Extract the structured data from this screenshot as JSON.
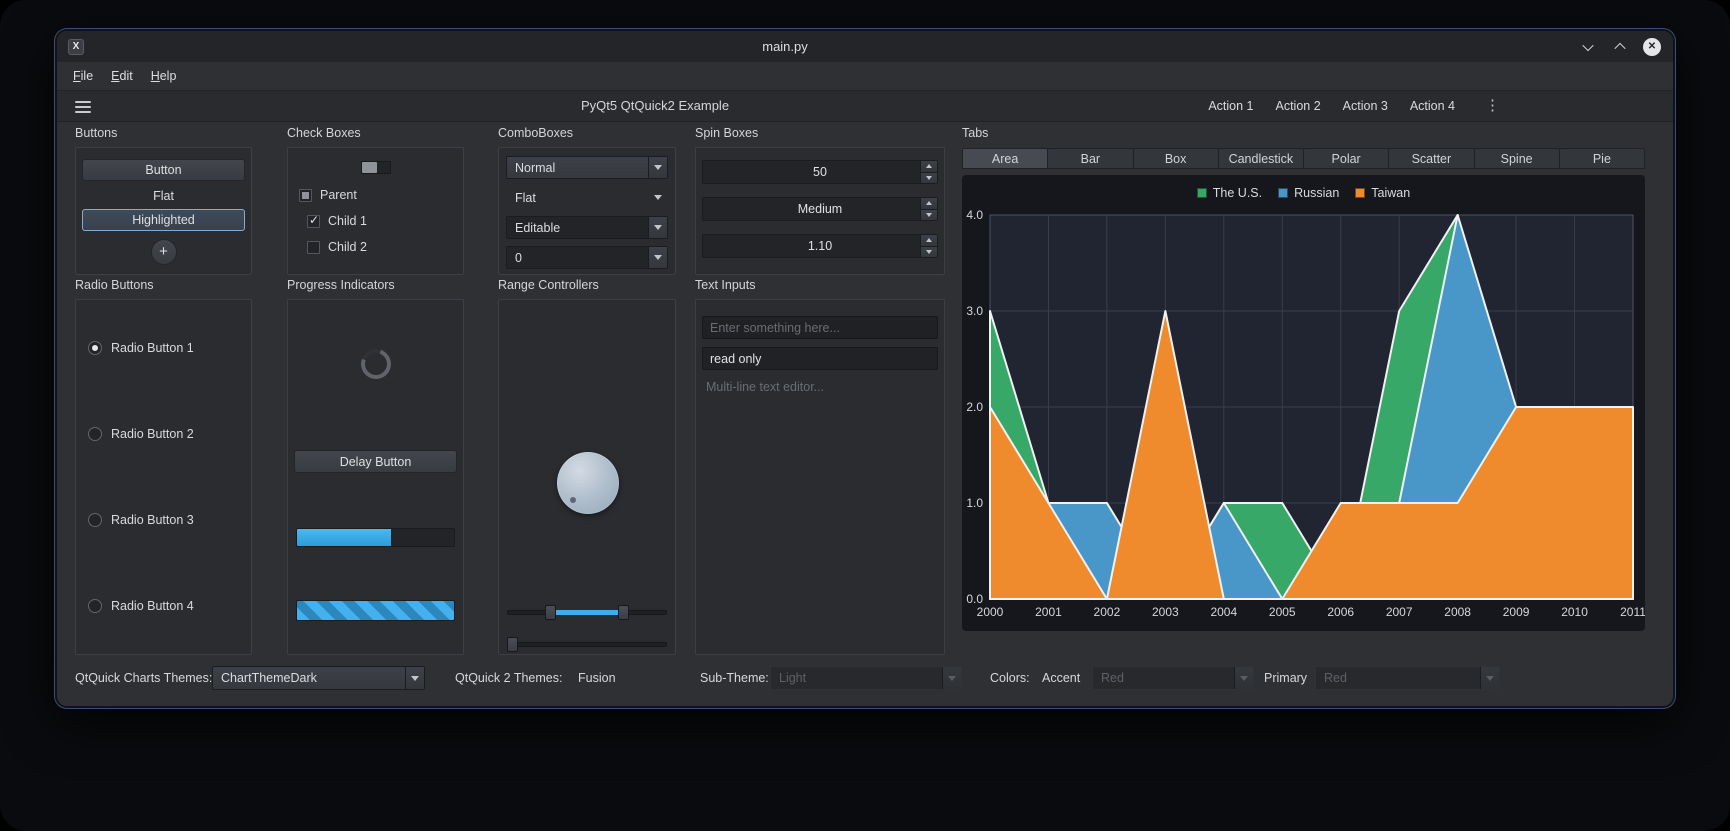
{
  "window": {
    "title": "main.py"
  },
  "icons": {
    "app": "X",
    "close": "✕",
    "round_plus": "+"
  },
  "menubar": {
    "items": [
      "File",
      "Edit",
      "Help"
    ]
  },
  "toolbar": {
    "title": "PyQt5 QtQuick2 Example",
    "actions": [
      "Action 1",
      "Action 2",
      "Action 3",
      "Action 4"
    ]
  },
  "groups": {
    "buttons": {
      "title": "Buttons",
      "normal": "Button",
      "flat": "Flat",
      "highlighted": "Highlighted",
      "round": "+"
    },
    "checkboxes": {
      "title": "Check Boxes",
      "parent": "Parent",
      "child1": "Child 1",
      "child2": "Child 2",
      "check_glyph": "✓"
    },
    "comboboxes": {
      "title": "ComboBoxes",
      "normal": "Normal",
      "flat": "Flat",
      "editable": "Editable",
      "editable_number": "0"
    },
    "spinboxes": {
      "title": "Spin Boxes",
      "values": [
        "50",
        "Medium",
        "1.10"
      ]
    },
    "tabs": {
      "title": "Tabs",
      "items": [
        "Area",
        "Bar",
        "Box",
        "Candlestick",
        "Polar",
        "Scatter",
        "Spine",
        "Pie"
      ],
      "selected": "Area"
    },
    "radios": {
      "title": "Radio Buttons",
      "items": [
        "Radio Button 1",
        "Radio Button 2",
        "Radio Button 3",
        "Radio Button 4"
      ],
      "selected_index": 0
    },
    "progress": {
      "title": "Progress Indicators",
      "delay_button": "Delay Button",
      "bar_value": 60
    },
    "range": {
      "title": "Range Controllers",
      "range_from": 27,
      "range_to": 73,
      "slider_value": 0
    },
    "text_inputs": {
      "title": "Text Inputs",
      "placeholder": "Enter something here...",
      "readonly_value": "read only",
      "multiline_placeholder": "Multi-line text editor..."
    }
  },
  "statusbar": {
    "charts_themes_label": "QtQuick Charts Themes:",
    "charts_theme_value": "ChartThemeDark",
    "qtquick2_label": "QtQuick 2 Themes:",
    "qtquick2_value": "Fusion",
    "subtheme_label": "Sub-Theme:",
    "subtheme_value": "Light",
    "colors_label": "Colors:",
    "accent_label": "Accent",
    "accent_value": "Red",
    "primary_label": "Primary",
    "primary_value": "Red"
  },
  "colors": {
    "accent_blue": "#3daee9",
    "highlight_border": "#83add0",
    "series_us_green": "#38a869",
    "series_russian_blue": "#4897c8",
    "series_taiwan_orange": "#f08b2d"
  },
  "chart_data": {
    "type": "area",
    "x": [
      2000,
      2001,
      2002,
      2003,
      2004,
      2005,
      2006,
      2007,
      2008,
      2009,
      2010,
      2011
    ],
    "series": [
      {
        "name": "The U.S.",
        "color": "#38a869",
        "values": [
          3,
          1,
          0,
          0,
          1,
          1,
          0,
          3,
          4,
          1,
          1,
          1
        ]
      },
      {
        "name": "Russian",
        "color": "#4897c8",
        "values": [
          1,
          1,
          1,
          0,
          1,
          0,
          0,
          1,
          4,
          2,
          1,
          1
        ]
      },
      {
        "name": "Taiwan",
        "color": "#f08b2d",
        "values": [
          2,
          1,
          0,
          3,
          0,
          0,
          1,
          1,
          1,
          2,
          2,
          2
        ]
      }
    ],
    "ylim": [
      0,
      4
    ],
    "yticks": [
      "0.0",
      "1.0",
      "2.0",
      "3.0",
      "4.0"
    ],
    "xlabel": "",
    "ylabel": "",
    "grid": true,
    "legend_position": "top",
    "legend_entries": [
      "The U.S.",
      "Russian",
      "Taiwan"
    ]
  }
}
